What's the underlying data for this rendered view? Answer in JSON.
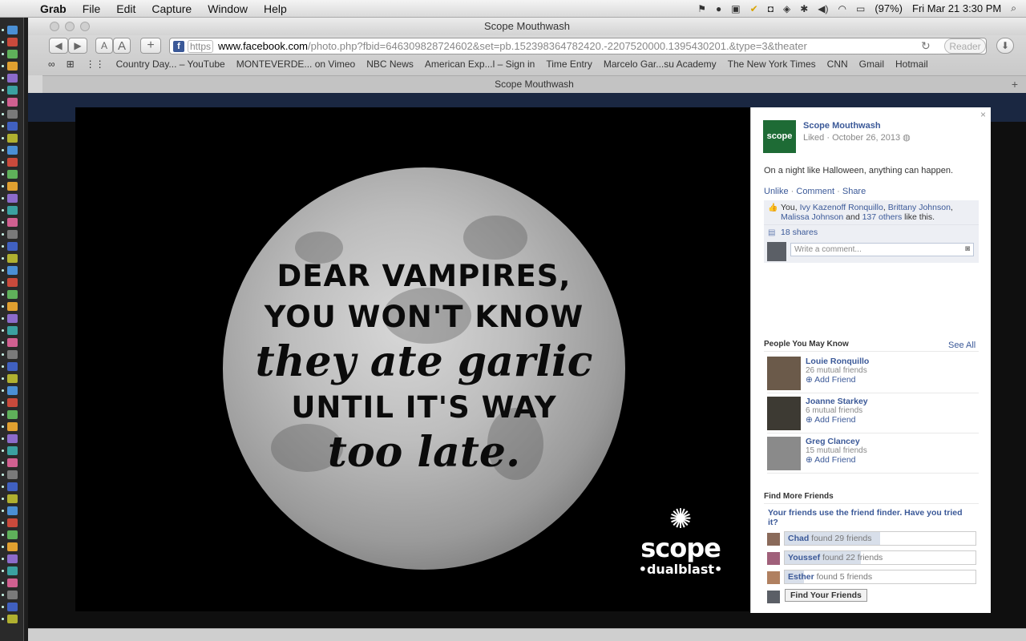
{
  "menubar": {
    "app": "Grab",
    "items": [
      "File",
      "Edit",
      "Capture",
      "Window",
      "Help"
    ],
    "battery": "(97%)",
    "clock": "Fri Mar 21  3:30 PM"
  },
  "window": {
    "title": "Scope Mouthwash",
    "url_scheme": "https",
    "url_host": "www.facebook.com",
    "url_path": "/photo.php?fbid=646309828724602&set=pb.152398364782420.-2207520000.1395430201.&type=3&theater",
    "reader_label": "Reader",
    "font_small": "A",
    "font_large": "A",
    "add_label": "+",
    "tab_title": "Scope Mouthwash",
    "bookmarks": [
      "Country Day... – YouTube",
      "MONTEVERDE... on Vimeo",
      "NBC News",
      "American Exp...l – Sign in",
      "Time Entry",
      "Marcelo Gar...su Academy",
      "The New York Times",
      "CNN",
      "Gmail",
      "Hotmail"
    ]
  },
  "photo": {
    "quote_line1": "DEAR VAMPIRES,",
    "quote_line2": "YOU WON'T KNOW",
    "quote_line3": "they ate garlic",
    "quote_line4": "UNTIL IT'S WAY",
    "quote_line5": "too late.",
    "brand_name": "scope",
    "brand_sub": "•dualblast•"
  },
  "panel": {
    "close": "×",
    "page_avatar_text": "scope",
    "page_name": "Scope Mouthwash",
    "liked_text": "Liked · October 26, 2013",
    "caption": "On a night like Halloween, anything can happen.",
    "action_unlike": "Unlike",
    "action_comment": "Comment",
    "action_share": "Share",
    "likes_prefix": "You, ",
    "liker1": "Ivy Kazenoff Ronquillo",
    "liker2": "Brittany Johnson",
    "liker3": "Malissa Johnson",
    "likes_and": " and ",
    "likes_others": "137 others",
    "likes_suffix": " like this.",
    "shares": "18 shares",
    "comment_placeholder": "Write a comment...",
    "pymk_title": "People You May Know",
    "see_all": "See All",
    "people": [
      {
        "name": "Louie Ronquillo",
        "mutual": "26 mutual friends",
        "add": "Add Friend"
      },
      {
        "name": "Joanne Starkey",
        "mutual": "6 mutual friends",
        "add": "Add Friend"
      },
      {
        "name": "Greg Clancey",
        "mutual": "15 mutual friends",
        "add": "Add Friend"
      }
    ],
    "find_more_title": "Find More Friends",
    "finder_question": "Your friends use the friend finder. Have you tried it?",
    "finders": [
      {
        "name": "Chad",
        "rest": " found 29 friends",
        "progress": 0.5
      },
      {
        "name": "Youssef",
        "rest": " found 22 friends",
        "progress": 0.4
      },
      {
        "name": "Esther",
        "rest": " found 5 friends",
        "progress": 0.1
      }
    ],
    "find_button": "Find Your Friends"
  },
  "colors": {
    "facebook_blue": "#3b5998",
    "scope_green": "#1e6b35"
  }
}
